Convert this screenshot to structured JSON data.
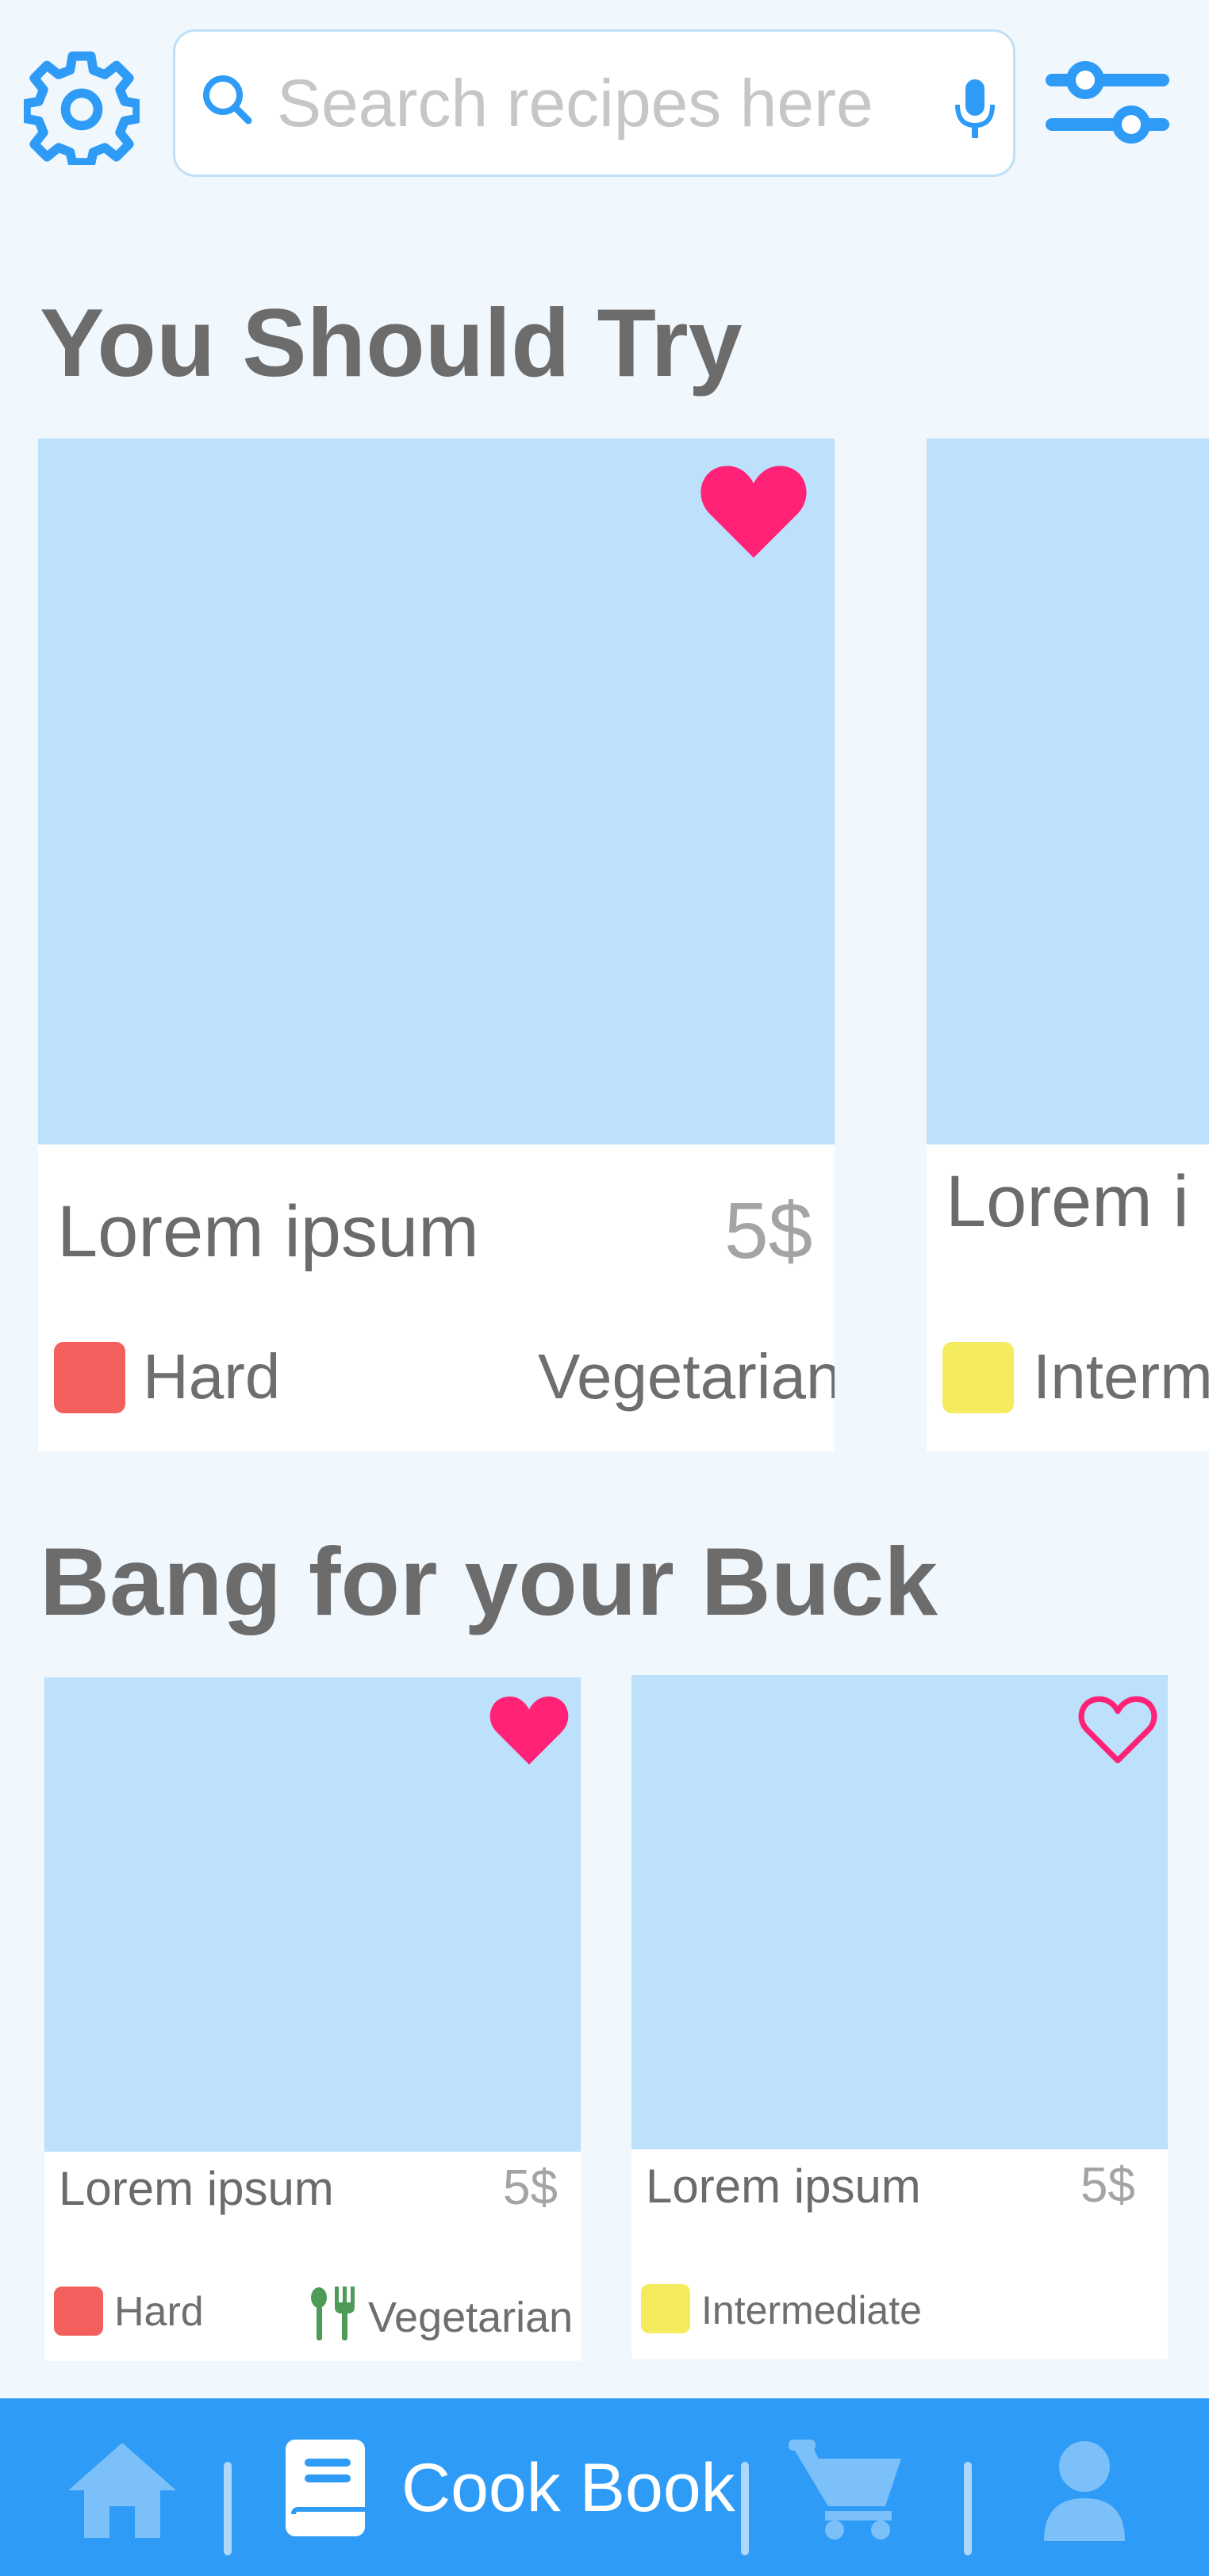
{
  "search": {
    "placeholder": "Search recipes here"
  },
  "sections": {
    "you_should_try": {
      "title": "You Should Try",
      "cards": [
        {
          "title": "Lorem ipsum",
          "price": "5$",
          "difficulty": "Hard",
          "diet": "Vegetarian",
          "favorited": true
        },
        {
          "title": "Lorem i",
          "difficulty": "Interm"
        }
      ]
    },
    "bang_for_buck": {
      "title": "Bang for your Buck",
      "cards": [
        {
          "title": "Lorem ipsum",
          "price": "5$",
          "difficulty": "Hard",
          "diet": "Vegetarian",
          "favorited": true
        },
        {
          "title": "Lorem ipsum",
          "price": "5$",
          "difficulty": "Intermediate",
          "favorited": false
        }
      ]
    }
  },
  "nav": {
    "active_label": "Cook Book",
    "items": [
      "home-icon",
      "cookbook-icon",
      "cart-icon",
      "profile-icon"
    ]
  },
  "colors": {
    "accent": "#2E9BF7",
    "heart": "#FF2277",
    "hard": "#F25F5C",
    "intermediate": "#F5EB5F",
    "veg_icon": "#4E9A57",
    "image_placeholder": "#BDE0FB"
  },
  "icons": [
    "gear-icon",
    "search-icon",
    "microphone-icon",
    "filter-sliders-icon",
    "heart-icon",
    "fork-knife-icon"
  ]
}
